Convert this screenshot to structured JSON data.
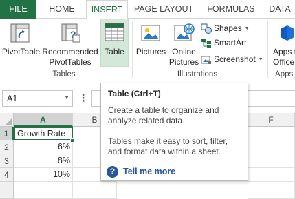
{
  "tabs": {
    "file": "FILE",
    "home": "HOME",
    "insert": "INSERT",
    "page_layout": "PAGE LAYOUT",
    "formulas": "FORMULAS",
    "data": "DATA"
  },
  "ribbon": {
    "pivot_table": "PivotTable",
    "recommended_pivot_1": "Recommended",
    "recommended_pivot_2": "PivotTables",
    "table": "Table",
    "group_tables": "Tables",
    "pictures": "Pictures",
    "online_pictures_1": "Online",
    "online_pictures_2": "Pictures",
    "shapes": "Shapes",
    "smartart": "SmartArt",
    "screenshot": "Screenshot",
    "group_illustrations": "Illustrations",
    "apps_1": "Apps f",
    "apps_2": "Office",
    "group_apps": "Apps"
  },
  "formula_bar": {
    "name_box": "A1",
    "formula": ""
  },
  "grid": {
    "columns": [
      "A",
      "B",
      "F"
    ],
    "rows": [
      "1",
      "2",
      "3",
      "4"
    ],
    "cells": {
      "a1": "Growth Rate",
      "a2": "6%",
      "a3": "8%",
      "a4": "10%"
    }
  },
  "tooltip": {
    "title": "Table (Ctrl+T)",
    "line1": "Create a table to organize and",
    "line2": "analyze related data.",
    "line3": "Tables make it easy to sort, filter,",
    "line4": "and format data within a sheet.",
    "help_link": "Tell me more"
  },
  "colors": {
    "excel_green": "#217346",
    "table_button_highlight": "#d4e8d9",
    "help_blue": "#2b579a"
  }
}
